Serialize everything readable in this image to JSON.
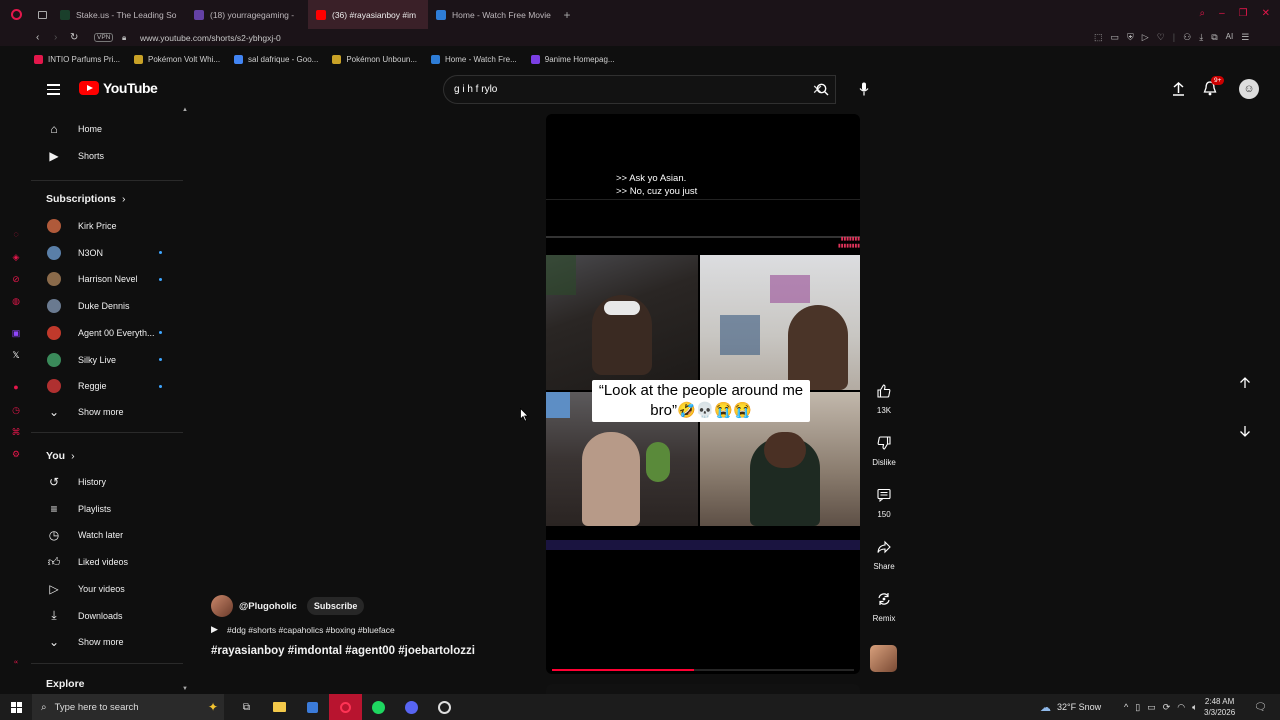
{
  "browser": {
    "tabs": [
      {
        "label": "Stake.us - The Leading So",
        "color": "#1a3f2b",
        "active": false
      },
      {
        "label": "(18) yourragegaming -",
        "color": "#6441a5",
        "active": false
      },
      {
        "label": "(36) #rayasianboy #im",
        "color": "#ff0000",
        "active": true
      },
      {
        "label": "Home - Watch Free Movie",
        "color": "#2e7dd7",
        "active": false
      }
    ],
    "vpn_label": "VPN",
    "url": "www.youtube.com/shorts/s2-ybhgxj-0",
    "bookmarks": [
      {
        "label": "INTIO Parfums Pri...",
        "color": "#e3174b"
      },
      {
        "label": "Pokémon Volt Whi...",
        "color": "#c9a227"
      },
      {
        "label": "sal dafrique - Goo...",
        "color": "#4285f4"
      },
      {
        "label": "Pokémon Unboun...",
        "color": "#c9a227"
      },
      {
        "label": "Home - Watch Fre...",
        "color": "#2e7dd7"
      },
      {
        "label": "9anime Homepag...",
        "color": "#7b3fe4"
      }
    ]
  },
  "youtube": {
    "logo_text": "YouTube",
    "search_value": "g i h f rylo",
    "notification_count": "9+",
    "sidebar": {
      "main": [
        {
          "label": "Home",
          "icon": "home-icon"
        },
        {
          "label": "Shorts",
          "icon": "shorts-icon"
        }
      ],
      "subscriptions_title": "Subscriptions",
      "subscriptions": [
        {
          "label": "Kirk Price",
          "color": "#b05a3a",
          "live": false
        },
        {
          "label": "N3ON",
          "color": "#5a7fa8",
          "live": true
        },
        {
          "label": "Harrison Nevel",
          "color": "#8a6a4a",
          "live": true
        },
        {
          "label": "Duke Dennis",
          "color": "#6a7a90",
          "live": false
        },
        {
          "label": "Agent 00 Everyth...",
          "color": "#c0392b",
          "live": true
        },
        {
          "label": "Silky Live",
          "color": "#3a8a5a",
          "live": true
        },
        {
          "label": "Reggie",
          "color": "#b03030",
          "live": true
        }
      ],
      "show_more": "Show more",
      "you_title": "You",
      "you": [
        {
          "label": "History",
          "icon": "history-icon"
        },
        {
          "label": "Playlists",
          "icon": "playlists-icon"
        },
        {
          "label": "Watch later",
          "icon": "watch-later-icon"
        },
        {
          "label": "Liked videos",
          "icon": "liked-icon"
        },
        {
          "label": "Your videos",
          "icon": "your-videos-icon"
        },
        {
          "label": "Downloads",
          "icon": "downloads-icon"
        }
      ],
      "show_more_2": "Show more",
      "explore_title": "Explore"
    },
    "short": {
      "caption_line1": ">> Ask yo Asian.",
      "caption_line2": ">> No, cuz you just",
      "quote": "“Look at the people around me bro”🤣💀😭😭",
      "channel": "@Plugoholic",
      "subscribe": "Subscribe",
      "tags_line": "#ddg #shorts #capaholics #boxing #blueface",
      "title": "#rayasianboy #imdontal #agent00 #joebartolozzi",
      "progress": 0.47,
      "likes": "13K",
      "dislike": "Dislike",
      "comments": "150",
      "share": "Share",
      "remix": "Remix"
    }
  },
  "taskbar": {
    "search_placeholder": "Type here to search",
    "weather": "32°F  Snow",
    "time": "2:48 AM",
    "date": "3/3/2026"
  }
}
